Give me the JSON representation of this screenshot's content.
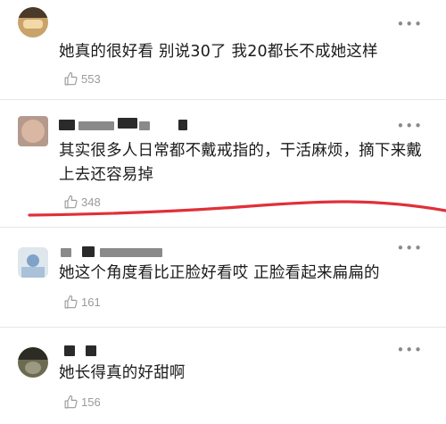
{
  "comments": [
    {
      "text": "她真的很好看 别说30了 我20都长不成她这样",
      "likes": "553"
    },
    {
      "text": "其实很多人日常都不戴戒指的，干活麻烦，摘下来戴上去还容易掉",
      "likes": "348"
    },
    {
      "text": "她这个角度看比正脸好看哎 正脸看起来扁扁的",
      "likes": "161"
    },
    {
      "text": "她长得真的好甜啊",
      "likes": "156"
    }
  ],
  "more_glyph": "•••",
  "icons": {
    "like": "thumbs-up-icon",
    "more": "more-dots-icon"
  },
  "colors": {
    "annotation_line": "#e0303a",
    "like_text": "#9a9a9a",
    "more_dots": "#8a8a8a"
  }
}
